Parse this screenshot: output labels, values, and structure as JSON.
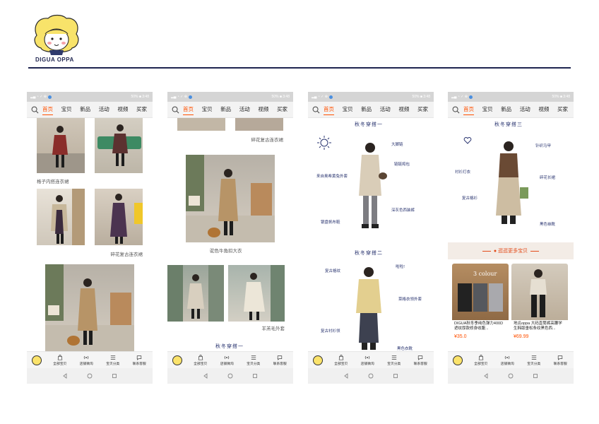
{
  "brand": {
    "name": "DIGUA OPPA"
  },
  "status": {
    "battery": "50% ■ 3:48"
  },
  "nav_tabs": [
    "首页",
    "宝贝",
    "新品",
    "活动",
    "视频",
    "买家"
  ],
  "tabbar": {
    "items": [
      {
        "label": "全部宝贝",
        "icon": "bag-icon"
      },
      {
        "label": "店铺微淘",
        "icon": "broadcast-icon"
      },
      {
        "label": "宝贝分类",
        "icon": "list-icon"
      },
      {
        "label": "联系客服",
        "icon": "chat-icon"
      }
    ]
  },
  "screen1": {
    "captions": [
      "格子内搭连衣裙",
      "碎花复古连衣裙"
    ]
  },
  "screen2": {
    "captions": [
      "碎花复古连衣裙",
      "驼色牛角扣大衣",
      "羊羔毛外套"
    ],
    "section": "秋冬穿搭一"
  },
  "screen3": {
    "section1": "秋冬穿搭一",
    "section2": "秋冬穿搭二",
    "notes1": [
      "大脚链",
      "链链挎包",
      "来自奥希黄兔外套",
      "深灰色西装裤",
      "银盘帆布鞋"
    ],
    "notes2": [
      "复古格纹",
      "啦啦!",
      "菜格衣领外套",
      "复古衬衫领",
      "黑色衣靴"
    ]
  },
  "screen4": {
    "section": "秋冬穿搭三",
    "notes": [
      "针织马甲",
      "衬衫灯衣",
      "复古格衫",
      "碎花长裙",
      "黑色袜靴"
    ],
    "banner": "逛逛更多宝贝",
    "products": [
      {
        "title": "DIGUA秋冬季纯色弹力400D遮纹厚款修身收腹...",
        "price": "¥35.0",
        "overlay": "3 colour"
      },
      {
        "title": "地瓜oppa 大码直筒裤高腰学生韩版垂松条纹黑色西...",
        "price": "¥69.99"
      }
    ]
  },
  "colors": {
    "accent": "#ff5000",
    "brand_navy": "#1f2550"
  }
}
